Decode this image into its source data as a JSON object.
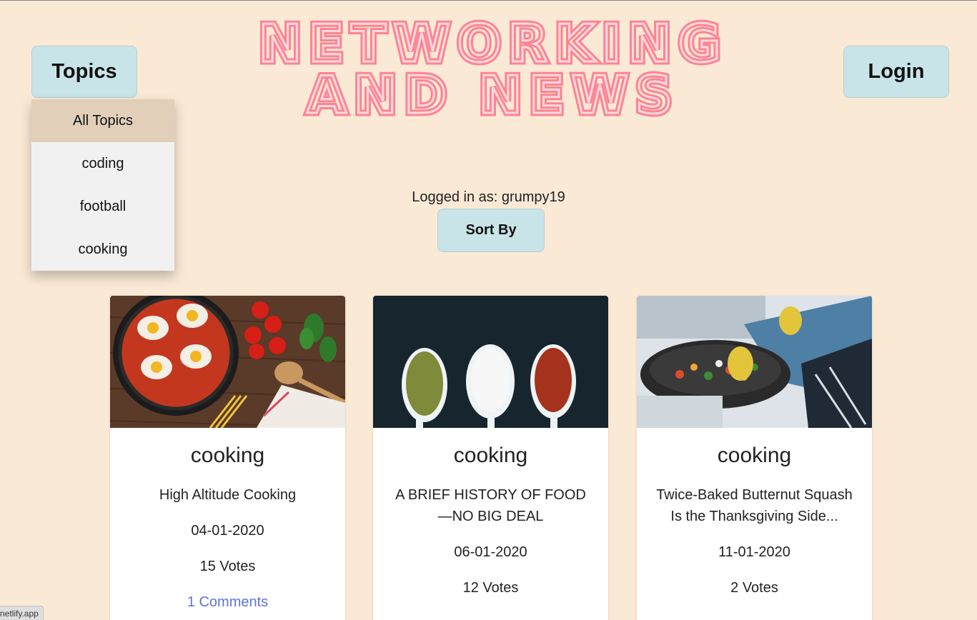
{
  "logo": {
    "line1": "NETWORKING",
    "line2": "AND NEWS"
  },
  "nav": {
    "topics_label": "Topics",
    "login_label": "Login"
  },
  "topics_menu": {
    "items": [
      "All Topics",
      "coding",
      "football",
      "cooking"
    ]
  },
  "user": {
    "logged_in_text": "Logged in as: grumpy19"
  },
  "sort": {
    "label": "Sort By"
  },
  "articles": [
    {
      "topic": "cooking",
      "title": "High Altitude Cooking",
      "date": "04-01-2020",
      "votes": "15 Votes",
      "comments": "1 Comments",
      "image": "shakshuka-pan-icon"
    },
    {
      "topic": "cooking",
      "title": "A BRIEF HISTORY OF FOOD —NO BIG DEAL",
      "date": "06-01-2020",
      "votes": "12 Votes",
      "comments": "",
      "image": "spice-spoons-icon"
    },
    {
      "topic": "cooking",
      "title": "Twice-Baked Butternut Squash Is the Thanksgiving Side...",
      "date": "11-01-2020",
      "votes": "2 Votes",
      "comments": "",
      "image": "wok-cooking-icon"
    }
  ],
  "status_bar": {
    "url": "netlify.app"
  },
  "colors": {
    "background": "#fae9d5",
    "button": "#c9e4e8",
    "neon": "#ff5a75",
    "link": "#5d74d4"
  }
}
